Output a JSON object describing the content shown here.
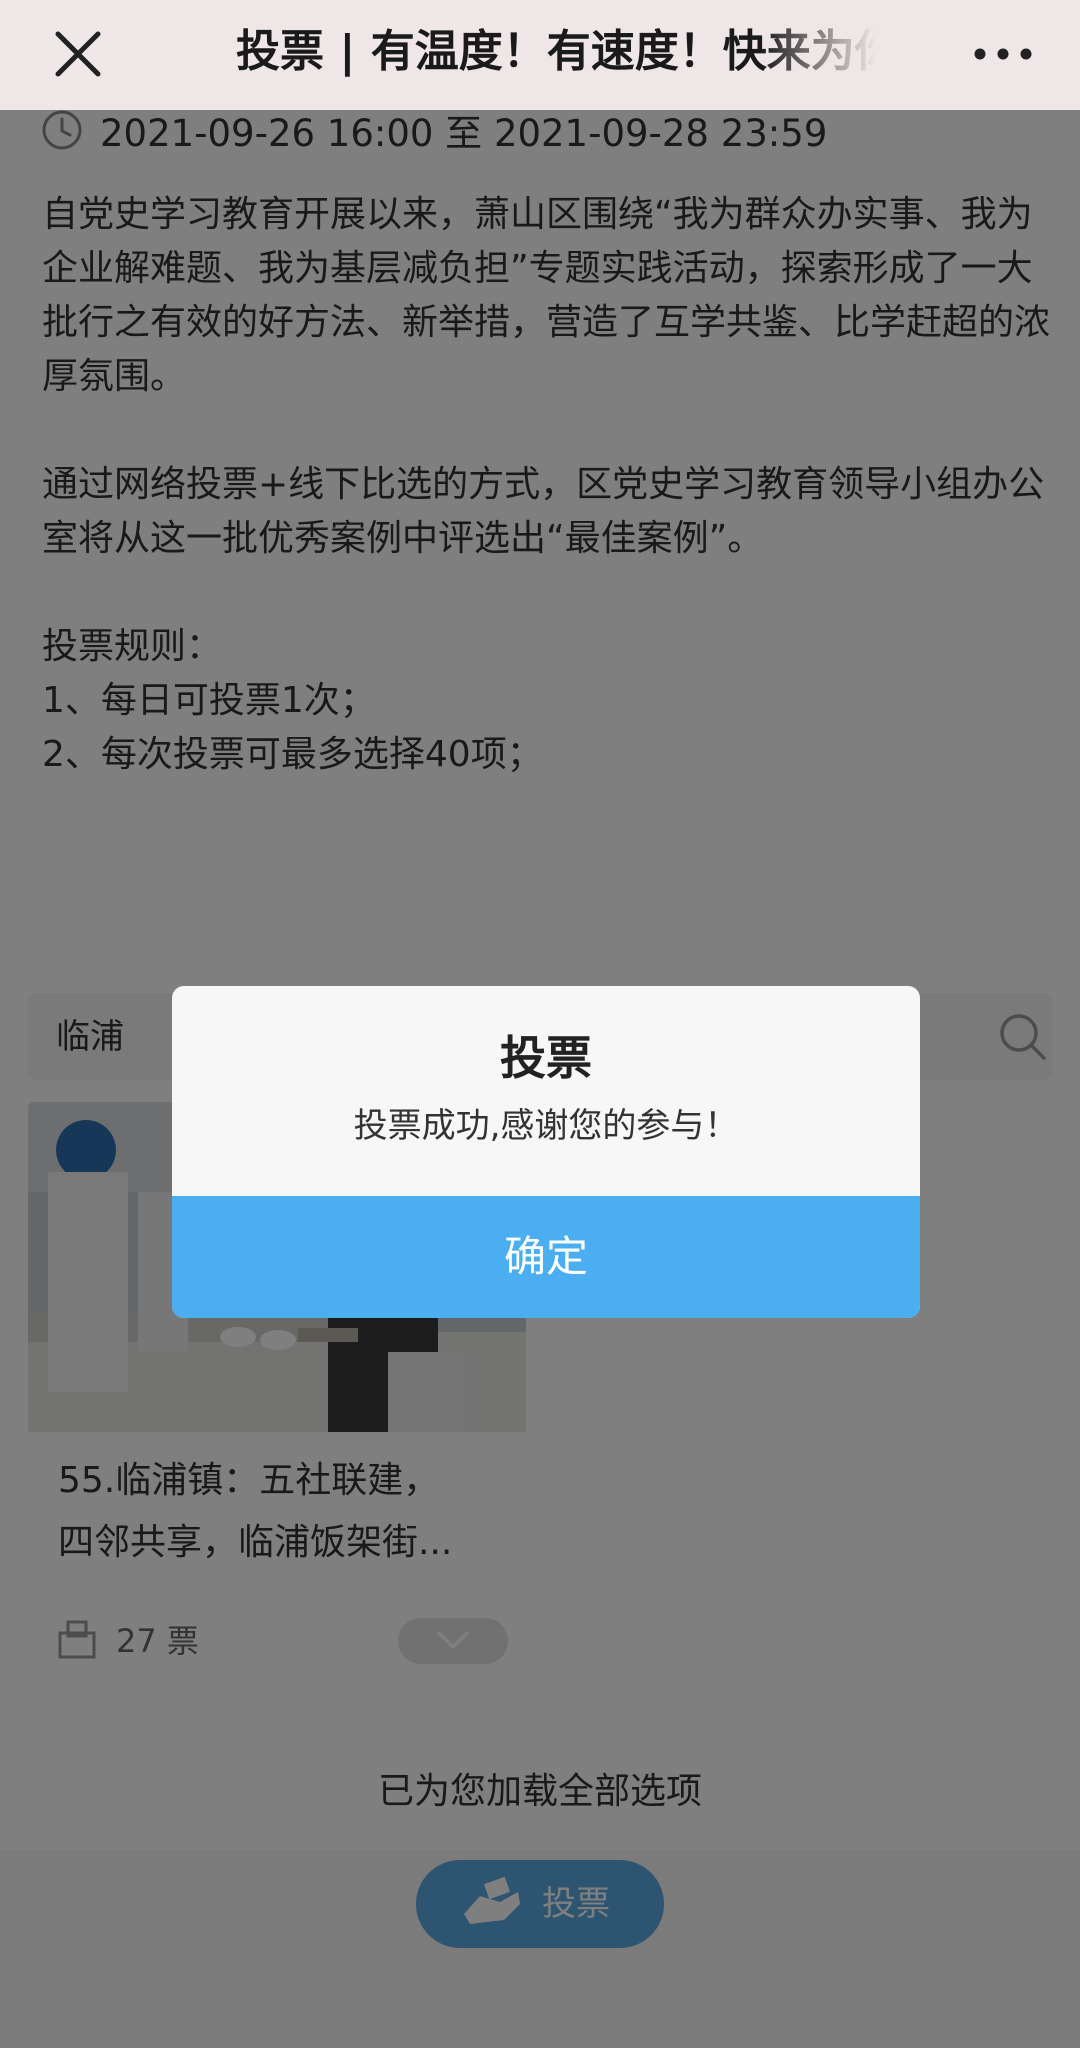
{
  "header": {
    "title": "投票 | 有温度！有速度！快来为你喜欢的案例投票吧",
    "close_icon": "close-icon",
    "more_icon": "more-dots-icon"
  },
  "event": {
    "date_range": "2021-09-26 16:00 至 2021-09-28 23:59",
    "intro_paragraph_1": "自党史学习教育开展以来，萧山区围绕“我为群众办实事、我为企业解难题、我为基层减负担”专题实践活动，探索形成了一大批行之有效的好方法、新举措，营造了互学共鉴、比学赶超的浓厚氛围。",
    "intro_paragraph_2": "通过网络投票+线下比选的方式，区党史学习教育领导小组办公室将从这一批优秀案例中评选出“最佳案例”。",
    "rules_title": "投票规则：",
    "rules": [
      "1、每日可投票1次；",
      "2、每次投票可最多选择40项；"
    ]
  },
  "search": {
    "value": "临浦",
    "icon": "search-icon"
  },
  "card": {
    "title_line_1": "55.临浦镇：五社联建，",
    "title_line_2": "四邻共享，临浦饭架街...",
    "votes": "27 票"
  },
  "footer": {
    "loaded_text": "已为您加载全部选项",
    "vote_button_label": "投票"
  },
  "dialog": {
    "title": "投票",
    "message": "投票成功,感谢您的参与！",
    "confirm_label": "确定"
  },
  "colors": {
    "dialog_button": "#4aaef0",
    "vote_button": "#5aa9e0",
    "topbar": "#efe7e7"
  }
}
